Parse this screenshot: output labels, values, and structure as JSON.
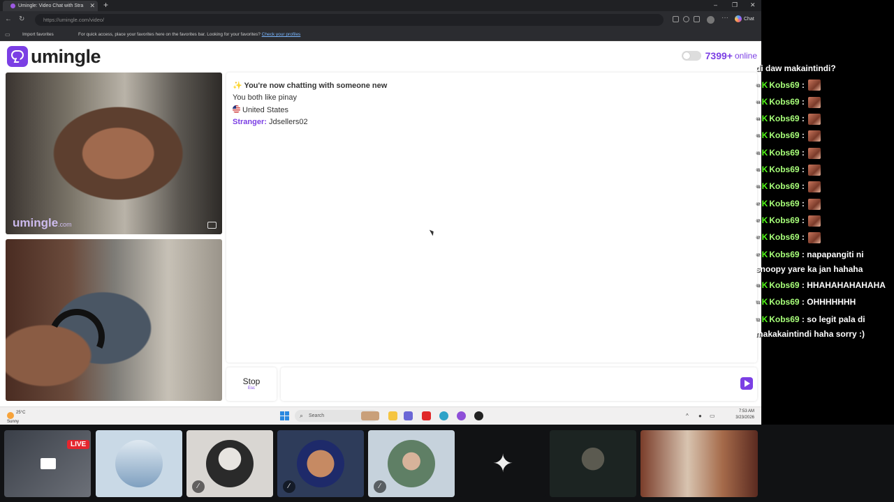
{
  "browser": {
    "tab_title": "Umingle: Video Chat with Stra",
    "url": "https://umingle.com/video/",
    "copilot_label": "Chat",
    "favorites": {
      "import_label": "Import favorites",
      "message": "For quick access, place your favorites here on the favorites bar. Looking for your favorites?",
      "link": "Check your profiles"
    }
  },
  "site": {
    "brand": "umingle",
    "brand_color": "#7b3fe4",
    "online_count": "7399+",
    "online_label": "online",
    "watermark": "umingle",
    "watermark_suffix": ".com"
  },
  "chat": {
    "status": "✨ You're now chatting with someone new",
    "interest": "You both like pinay",
    "country": "United States",
    "stranger_label": "Stranger:",
    "stranger_name": "Jdsellers02",
    "stop_label": "Stop",
    "stop_key": "Esc",
    "message_value": ""
  },
  "taskbar": {
    "temperature": "25°C",
    "weather": "Sunny",
    "search_placeholder": "Search",
    "time": "7:53 AM",
    "date": "3/23/2026"
  },
  "overlay": {
    "partial_first": "di daw makaintindi?",
    "messages": [
      {
        "ts": "43",
        "user": "Kobs69",
        "text": "",
        "emote": true
      },
      {
        "ts": "44",
        "user": "Kobs69",
        "text": "",
        "emote": true
      },
      {
        "ts": "44",
        "user": "Kobs69",
        "text": "",
        "emote": true
      },
      {
        "ts": "45",
        "user": "Kobs69",
        "text": "",
        "emote": true
      },
      {
        "ts": "45",
        "user": "Kobs69",
        "text": "",
        "emote": true
      },
      {
        "ts": "45",
        "user": "Kobs69",
        "text": "",
        "emote": true
      },
      {
        "ts": "46",
        "user": "Kobs69",
        "text": "",
        "emote": true
      },
      {
        "ts": "47",
        "user": "Kobs69",
        "text": "",
        "emote": true
      },
      {
        "ts": "47",
        "user": "Kobs69",
        "text": "",
        "emote": true
      },
      {
        "ts": "47",
        "user": "Kobs69",
        "text": "",
        "emote": true
      },
      {
        "ts": "47",
        "user": "Kobs69",
        "text": "napapangiti ni snoopy yare ka jan hahaha",
        "emote": false
      },
      {
        "ts": "48",
        "user": "Kobs69",
        "text": "HHAHAHAHAHAHA",
        "emote": false
      },
      {
        "ts": "51",
        "user": "Kobs69",
        "text": "OHHHHHHH",
        "emote": false
      },
      {
        "ts": "52",
        "user": "Kobs69",
        "text": "so legit pala di makakaintindi haha sorry :)",
        "emote": false
      }
    ]
  },
  "strip": {
    "live_badge": "LIVE"
  }
}
